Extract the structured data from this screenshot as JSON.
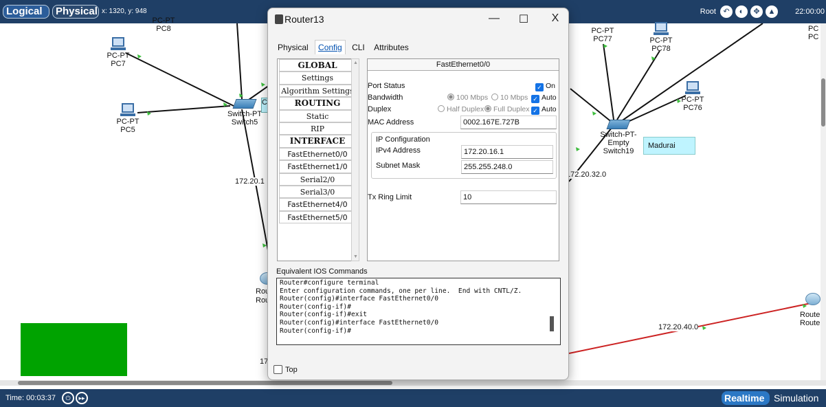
{
  "topbar": {
    "logical": "Logical",
    "physical": "Physical",
    "coords": "x: 1320, y: 948",
    "root": "Root",
    "clock": "22:00:00"
  },
  "canvas": {
    "devices": {
      "pc8": {
        "type": "PC-PT",
        "name": "PC8"
      },
      "pc7": {
        "type": "PC-PT",
        "name": "PC7"
      },
      "pc5": {
        "type": "PC-PT",
        "name": "PC5"
      },
      "switch5": {
        "type": "Switch-PT",
        "name": "Switch5"
      },
      "pc77": {
        "type": "PC-PT",
        "name": "PC77"
      },
      "pc78": {
        "type": "PC-PT",
        "name": "PC78"
      },
      "pc76": {
        "type": "PC-PT",
        "name": "PC76"
      },
      "pc_partial": {
        "type": "PC",
        "name": "PC"
      },
      "switch19": {
        "type": "Switch-PT-Empty",
        "name": "Switch19"
      },
      "router_left": {
        "type": "Rou",
        "name": "Rou"
      },
      "router_right": {
        "type": "Router",
        "name": "Route"
      }
    },
    "labels": {
      "net_left": "172.20.1",
      "net_right": "172.20.32.0",
      "net_bottom": "172.20.40.0",
      "net_bottom_left": "17",
      "c_fragment": "C"
    },
    "note": "Madurai"
  },
  "dialog": {
    "title": "Router13",
    "controls": {
      "minimize": "—",
      "maximize": "☐",
      "close": "X"
    },
    "tabs": [
      "Physical",
      "Config",
      "CLI",
      "Attributes"
    ],
    "menu": [
      {
        "label": "GLOBAL",
        "kind": "hdr"
      },
      {
        "label": "Settings",
        "kind": "item"
      },
      {
        "label": "Algorithm Settings",
        "kind": "item"
      },
      {
        "label": "ROUTING",
        "kind": "hdr"
      },
      {
        "label": "Static",
        "kind": "item"
      },
      {
        "label": "RIP",
        "kind": "item"
      },
      {
        "label": "INTERFACE",
        "kind": "hdr"
      },
      {
        "label": "FastEthernet0/0",
        "kind": "if"
      },
      {
        "label": "FastEthernet1/0",
        "kind": "if"
      },
      {
        "label": "Serial2/0",
        "kind": "item"
      },
      {
        "label": "Serial3/0",
        "kind": "item"
      },
      {
        "label": "FastEthernet4/0",
        "kind": "if"
      },
      {
        "label": "FastEthernet5/0",
        "kind": "if"
      }
    ],
    "panel": {
      "title": "FastEthernet0/0",
      "port_status_label": "Port Status",
      "port_status_value": "On",
      "bandwidth_label": "Bandwidth",
      "bw_100": "100 Mbps",
      "bw_10": "10 Mbps",
      "bw_auto": "Auto",
      "duplex_label": "Duplex",
      "half": "Half Duplex",
      "full": "Full Duplex",
      "duplex_auto": "Auto",
      "mac_label": "MAC Address",
      "mac_value": "0002.167E.727B",
      "ip_config_label": "IP Configuration",
      "ipv4_label": "IPv4 Address",
      "ipv4_value": "172.20.16.1",
      "mask_label": "Subnet Mask",
      "mask_value": "255.255.248.0",
      "tx_label": "Tx Ring Limit",
      "tx_value": "10"
    },
    "ios_label": "Equivalent IOS Commands",
    "ios_lines": [
      "Router#configure terminal",
      "Enter configuration commands, one per line.  End with CNTL/Z.",
      "Router(config)#interface FastEthernet0/0",
      "Router(config-if)#",
      "Router(config-if)#exit",
      "Router(config)#interface FastEthernet0/0",
      "Router(config-if)#"
    ],
    "top_label": "Top"
  },
  "bottombar": {
    "time": "Time: 00:03:37",
    "realtime": "Realtime",
    "simulation": "Simulation"
  },
  "colors": {
    "bar": "#1f3f66",
    "link_red": "#cc2222",
    "note_bg": "#bff4ff",
    "green_block": "#00a300"
  }
}
